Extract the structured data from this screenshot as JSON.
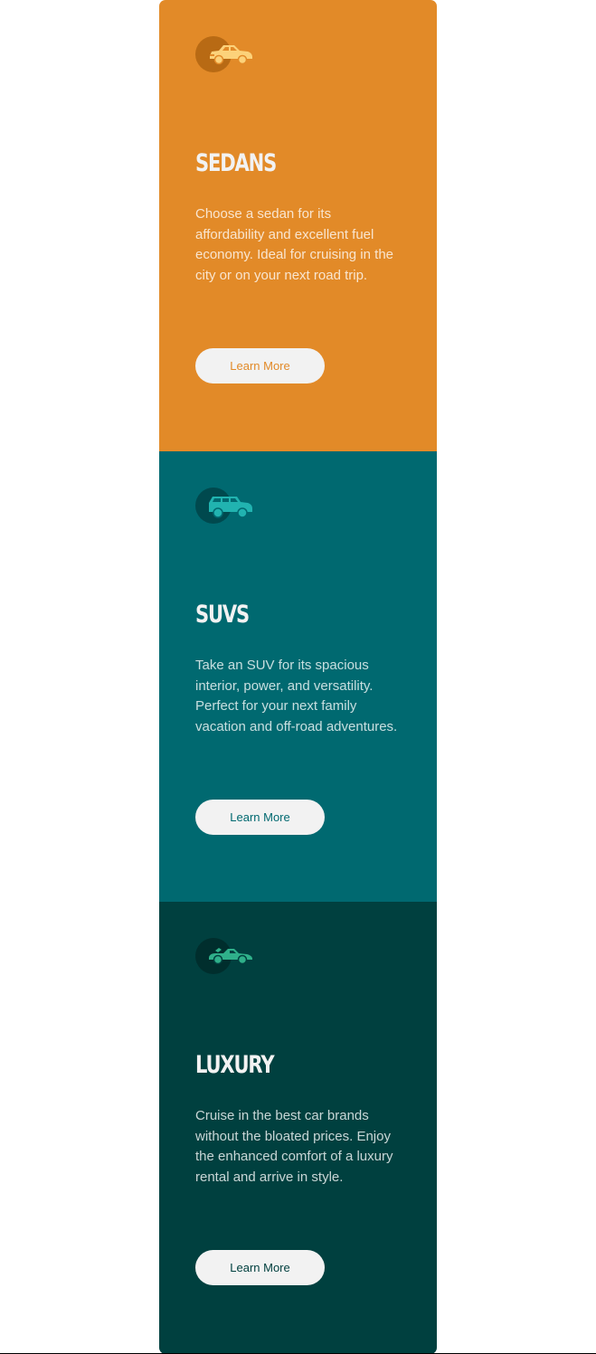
{
  "cards": [
    {
      "title": "SEDANS",
      "description": "Choose a sedan for its affordability and excellent fuel economy. Ideal for cruising in the city or on your next road trip.",
      "button_label": "Learn More",
      "icon": "sedan-car-icon",
      "color": "#e28a28",
      "icon_color": "#fcd27a"
    },
    {
      "title": "SUVS",
      "description": "Take an SUV for its spacious interior, power, and versatility. Perfect for your next family vacation and off-road adventures.",
      "button_label": "Learn More",
      "icon": "suv-car-icon",
      "color": "#006970",
      "icon_color": "#21b3b0"
    },
    {
      "title": "LUXURY",
      "description": "Cruise in the best car brands without the bloated prices. Enjoy the enhanced comfort of a luxury rental and arrive in style.",
      "button_label": "Learn More",
      "icon": "luxury-car-icon",
      "color": "#00403f",
      "icon_color": "#2fb08a"
    }
  ]
}
